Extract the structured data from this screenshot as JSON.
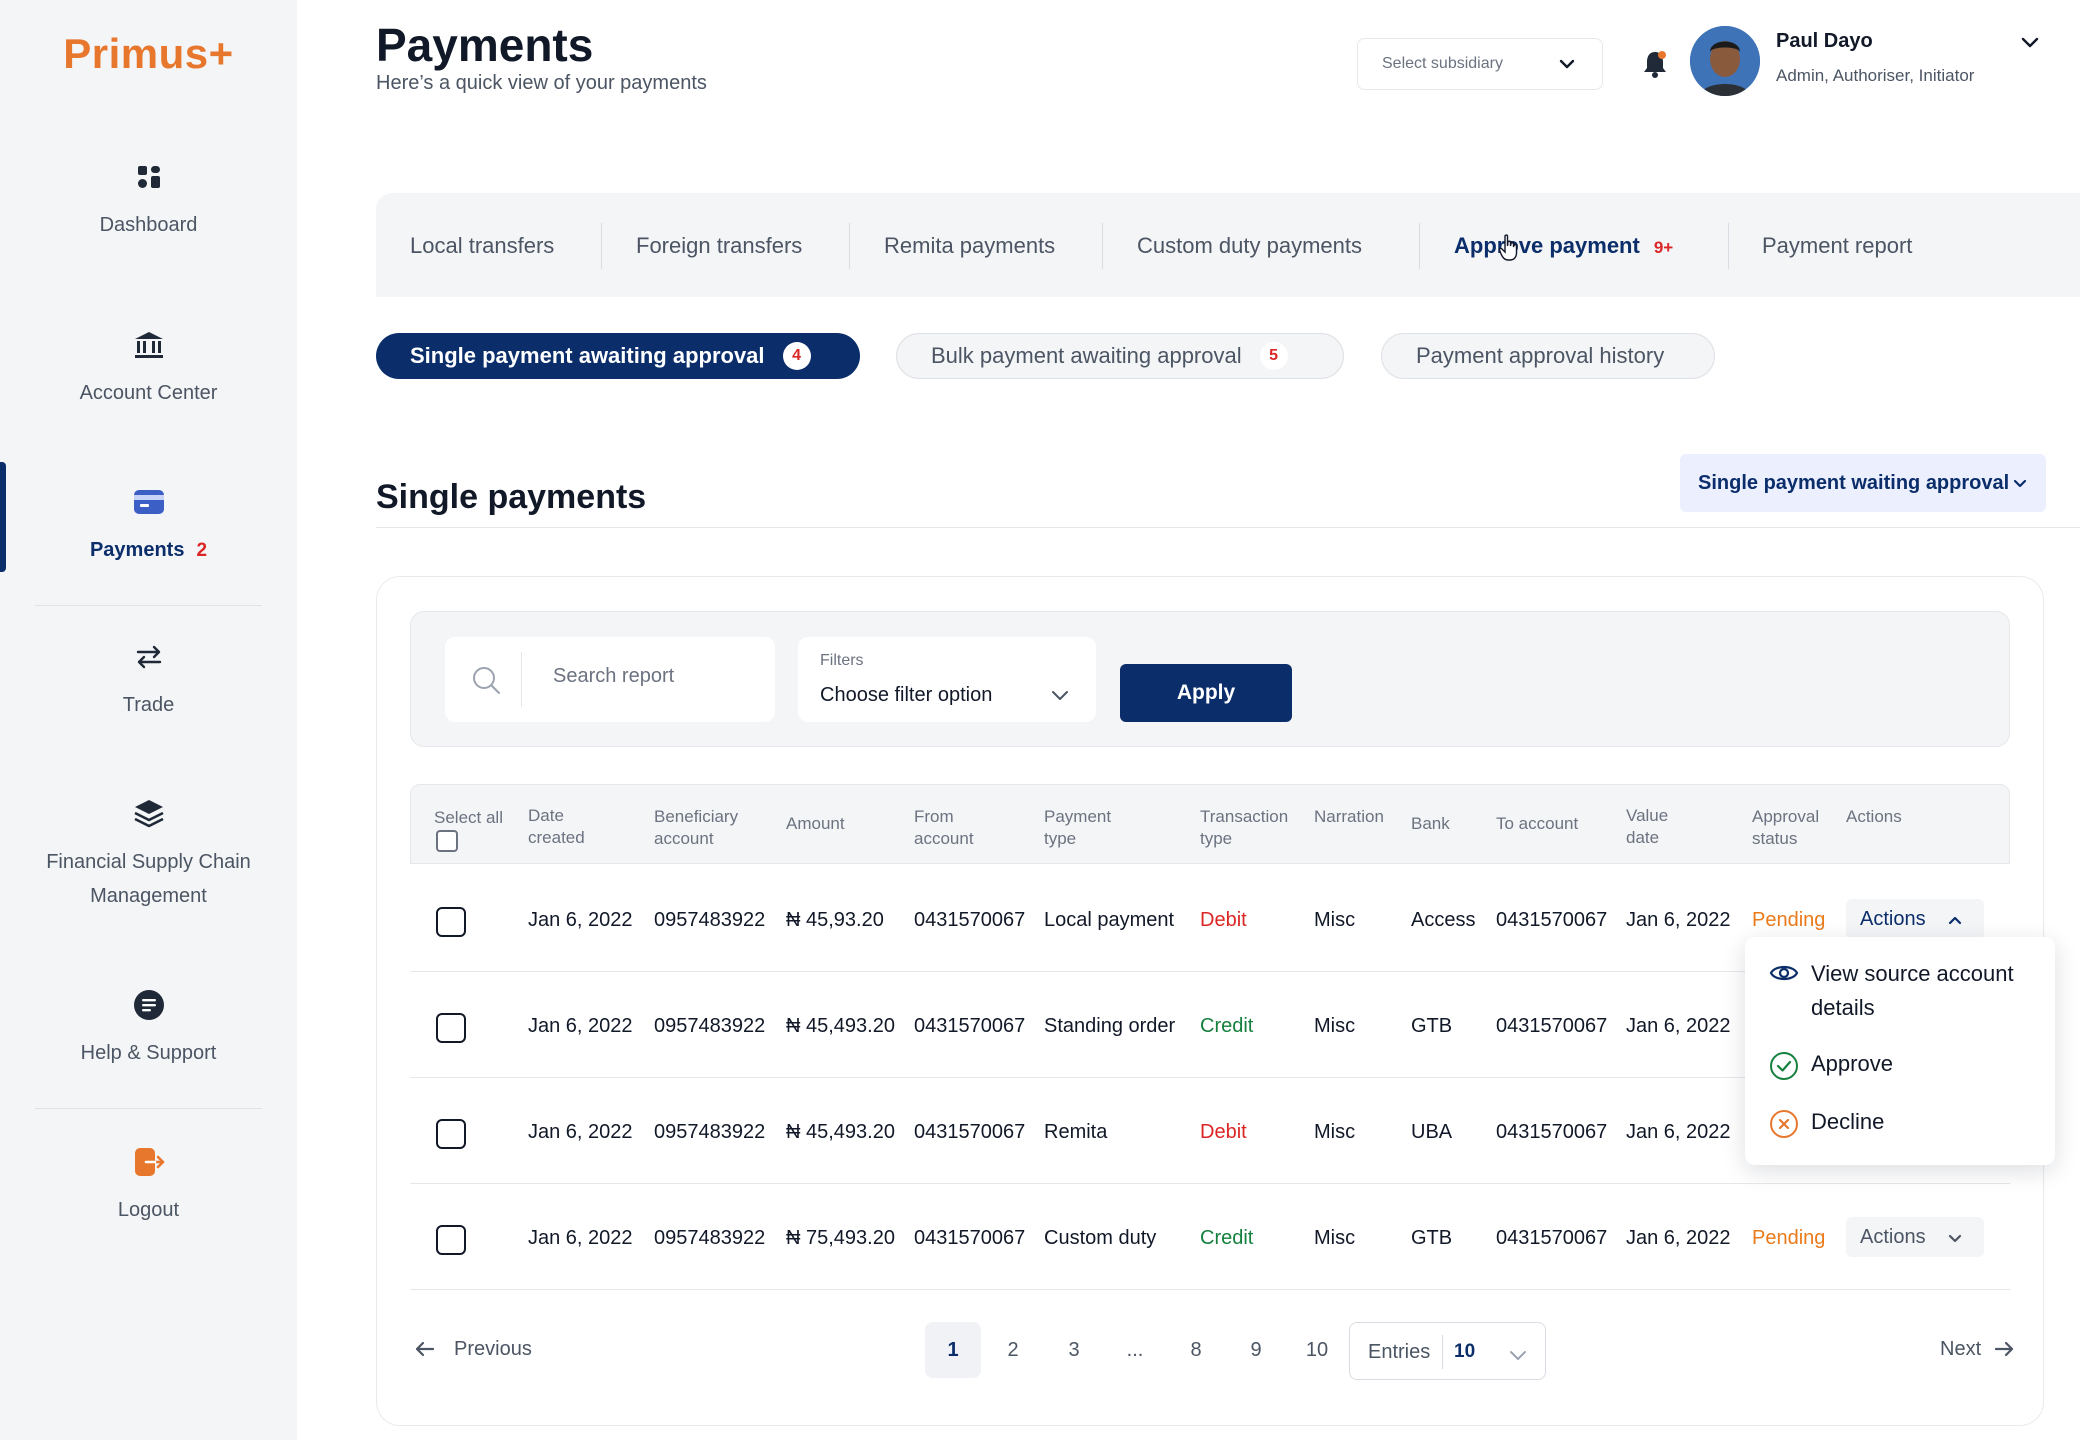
{
  "app": {
    "logo": "Primus+"
  },
  "sidebar": {
    "items": [
      {
        "label": "Dashboard",
        "icon": "dashboard-icon"
      },
      {
        "label": "Account Center",
        "icon": "bank-icon"
      },
      {
        "label": "Payments",
        "icon": "card-icon",
        "badge": "2",
        "active": true
      },
      {
        "label": "Trade",
        "icon": "swap-icon"
      },
      {
        "label": "Financial Supply Chain Management",
        "icon": "layers-icon"
      },
      {
        "label": "Help & Support",
        "icon": "help-icon"
      },
      {
        "label": "Logout",
        "icon": "logout-icon"
      }
    ]
  },
  "header": {
    "title": "Payments",
    "subtitle": "Here’s a quick view of your payments",
    "subsidiary_placeholder": "Select subsidiary",
    "user": {
      "name": "Paul Dayo",
      "roles": "Admin, Authoriser, Initiator"
    }
  },
  "tabs": [
    {
      "label": "Local transfers"
    },
    {
      "label": "Foreign transfers"
    },
    {
      "label": "Remita payments"
    },
    {
      "label": "Custom duty payments"
    },
    {
      "label": "Approve payment",
      "badge": "9+",
      "active": true
    },
    {
      "label": "Payment report"
    }
  ],
  "pills": [
    {
      "label": "Single payment awaiting approval",
      "badge": "4",
      "active": true
    },
    {
      "label": "Bulk payment awaiting approval",
      "badge": "5"
    },
    {
      "label": "Payment approval history"
    }
  ],
  "section": {
    "title": "Single payments",
    "dropdown_value": "Single payment waiting approval"
  },
  "filters": {
    "search_placeholder": "Search report",
    "filter_label": "Filters",
    "filter_value": "Choose filter option",
    "apply_label": "Apply"
  },
  "table": {
    "headers": {
      "select_all": "Select all",
      "date_created": [
        "Date",
        "created"
      ],
      "beneficiary": [
        "Beneficiary",
        "account"
      ],
      "amount": "Amount",
      "from_account": [
        "From",
        "account"
      ],
      "payment_type": [
        "Payment",
        "type"
      ],
      "transaction_type": [
        "Transaction",
        "type"
      ],
      "narration": "Narration",
      "bank": "Bank",
      "to_account": "To account",
      "value_date": [
        "Value",
        "date"
      ],
      "approval_status": [
        "Approval",
        "status"
      ],
      "actions": "Actions"
    },
    "rows": [
      {
        "date": "Jan 6, 2022",
        "beneficiary": "0957483922",
        "amount": "₦ 45,93.20",
        "from": "0431570067",
        "payment_type": "Local payment",
        "txn_type": "Debit",
        "narration": "Misc",
        "bank": "Access",
        "to": "0431570067",
        "value_date": "Jan 6, 2022",
        "status": "Pending",
        "actions": "Actions"
      },
      {
        "date": "Jan 6, 2022",
        "beneficiary": "0957483922",
        "amount": "₦ 45,493.20",
        "from": "0431570067",
        "payment_type": "Standing order",
        "txn_type": "Credit",
        "narration": "Misc",
        "bank": "GTB",
        "to": "0431570067",
        "value_date": "Jan 6, 2022"
      },
      {
        "date": "Jan 6, 2022",
        "beneficiary": "0957483922",
        "amount": "₦ 45,493.20",
        "from": "0431570067",
        "payment_type": "Remita",
        "txn_type": "Debit",
        "narration": "Misc",
        "bank": "UBA",
        "to": "0431570067",
        "value_date": "Jan 6, 2022"
      },
      {
        "date": "Jan 6, 2022",
        "beneficiary": "0957483922",
        "amount": "₦ 75,493.20",
        "from": "0431570067",
        "payment_type": "Custom duty",
        "txn_type": "Credit",
        "narration": "Misc",
        "bank": "GTB",
        "to": "0431570067",
        "value_date": "Jan 6, 2022",
        "status": "Pending",
        "actions": "Actions"
      }
    ]
  },
  "actions_menu": {
    "items": [
      {
        "label": "View source account details",
        "icon": "eye-icon"
      },
      {
        "label": "Approve",
        "icon": "check-circle-icon"
      },
      {
        "label": "Decline",
        "icon": "x-circle-icon"
      }
    ]
  },
  "pagination": {
    "previous": "Previous",
    "next": "Next",
    "pages": [
      "1",
      "2",
      "3",
      "...",
      "8",
      "9",
      "10"
    ],
    "current": "1",
    "entries_label": "Entries",
    "entries_value": "10"
  },
  "colors": {
    "primary": "#0b2e6b",
    "brand": "#e8772e",
    "debit": "#dc2626",
    "credit": "#15803d",
    "pending": "#ea7a1a"
  }
}
